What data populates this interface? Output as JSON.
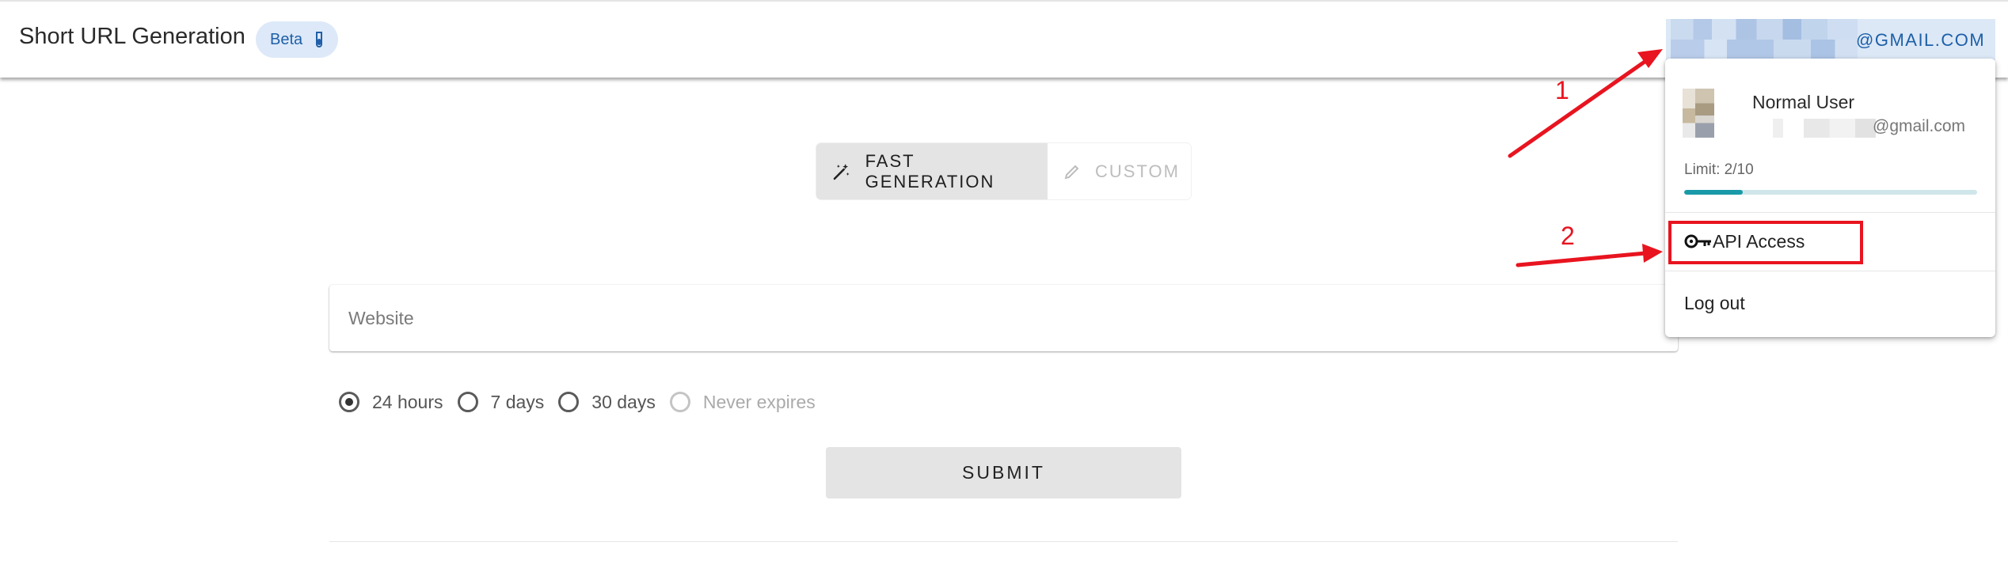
{
  "header": {
    "title": "Short URL Generation",
    "beta_label": "Beta",
    "account_label": "@GMAIL.COM"
  },
  "mode_toggle": {
    "fast_label": "FAST GENERATION",
    "custom_label": "CUSTOM",
    "selected": "fast"
  },
  "form": {
    "website_placeholder": "Website",
    "website_value": "",
    "expiry_options": [
      {
        "label": "24 hours",
        "checked": true,
        "disabled": false
      },
      {
        "label": "7 days",
        "checked": false,
        "disabled": false
      },
      {
        "label": "30 days",
        "checked": false,
        "disabled": false
      },
      {
        "label": "Never expires",
        "checked": false,
        "disabled": true
      }
    ],
    "submit_label": "SUBMIT"
  },
  "account_menu": {
    "user_name": "Normal User",
    "email_domain": "@gmail.com",
    "limit_label": "Limit: 2/10",
    "limit_fraction": 0.2,
    "api_access_label": "API Access",
    "logout_label": "Log out"
  },
  "annotations": {
    "step_1": "1",
    "step_2": "2",
    "color": "#e8141f"
  },
  "colors": {
    "accent_blue": "#1d5fa8",
    "progress_teal": "#1a9aa8",
    "chip_bg": "#dde9f8"
  }
}
